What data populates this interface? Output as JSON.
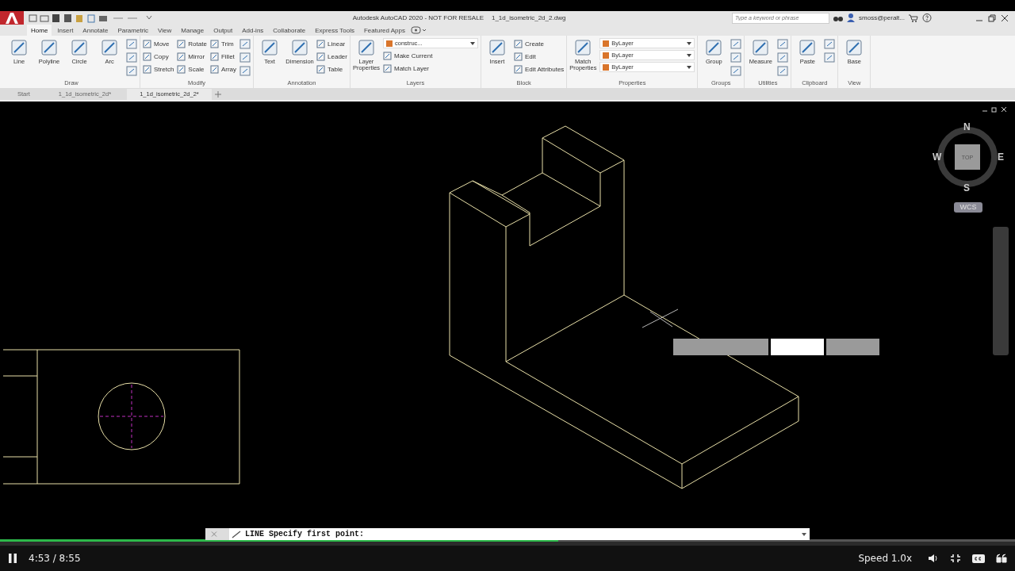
{
  "app": {
    "title": "Autodesk AutoCAD 2020 - NOT FOR RESALE",
    "file": "1_1d_isometric_2d_2.dwg",
    "search_placeholder": "Type a keyword or phrase",
    "user": "smoss@peralt..."
  },
  "ribbon_tabs": [
    {
      "label": "Home",
      "selected": true
    },
    {
      "label": "Insert",
      "selected": false
    },
    {
      "label": "Annotate",
      "selected": false
    },
    {
      "label": "Parametric",
      "selected": false
    },
    {
      "label": "View",
      "selected": false
    },
    {
      "label": "Manage",
      "selected": false
    },
    {
      "label": "Output",
      "selected": false
    },
    {
      "label": "Add-ins",
      "selected": false
    },
    {
      "label": "Collaborate",
      "selected": false
    },
    {
      "label": "Express Tools",
      "selected": false
    },
    {
      "label": "Featured Apps",
      "selected": false
    }
  ],
  "panels": [
    {
      "title": "Draw",
      "columns": [
        [
          {
            "kind": "large",
            "label": "Line"
          }
        ],
        [
          {
            "kind": "large",
            "label": "Polyline"
          }
        ],
        [
          {
            "kind": "large",
            "label": "Circle"
          }
        ],
        [
          {
            "kind": "large",
            "label": "Arc"
          }
        ],
        [
          {
            "kind": "icon"
          },
          {
            "kind": "icon"
          },
          {
            "kind": "icon"
          }
        ]
      ]
    },
    {
      "title": "Modify",
      "columns": [
        [
          {
            "kind": "small",
            "label": "Move"
          },
          {
            "kind": "small",
            "label": "Copy"
          },
          {
            "kind": "small",
            "label": "Stretch"
          }
        ],
        [
          {
            "kind": "small",
            "label": "Rotate"
          },
          {
            "kind": "small",
            "label": "Mirror"
          },
          {
            "kind": "small",
            "label": "Scale"
          }
        ],
        [
          {
            "kind": "small",
            "label": "Trim"
          },
          {
            "kind": "small",
            "label": "Fillet"
          },
          {
            "kind": "small",
            "label": "Array"
          }
        ],
        [
          {
            "kind": "icon"
          },
          {
            "kind": "icon"
          },
          {
            "kind": "icon"
          }
        ]
      ]
    },
    {
      "title": "Annotation",
      "columns": [
        [
          {
            "kind": "large",
            "label": "Text"
          }
        ],
        [
          {
            "kind": "large",
            "label": "Dimension"
          }
        ],
        [
          {
            "kind": "small",
            "label": "Linear"
          },
          {
            "kind": "small",
            "label": "Leader"
          },
          {
            "kind": "small",
            "label": "Table"
          }
        ]
      ]
    },
    {
      "title": "Layers",
      "columns": [
        [
          {
            "kind": "large",
            "label": "Layer Properties"
          }
        ],
        [
          {
            "kind": "dropdown",
            "label": "construc..."
          },
          {
            "kind": "small",
            "label": "Make Current"
          },
          {
            "kind": "small",
            "label": "Match Layer"
          }
        ]
      ]
    },
    {
      "title": "Block",
      "columns": [
        [
          {
            "kind": "large",
            "label": "Insert"
          }
        ],
        [
          {
            "kind": "small",
            "label": "Create"
          },
          {
            "kind": "small",
            "label": "Edit"
          },
          {
            "kind": "small",
            "label": "Edit Attributes"
          }
        ]
      ]
    },
    {
      "title": "Properties",
      "columns": [
        [
          {
            "kind": "large",
            "label": "Match Properties"
          }
        ],
        [
          {
            "kind": "dropdown",
            "label": "ByLayer"
          },
          {
            "kind": "dropdown",
            "label": "ByLayer"
          },
          {
            "kind": "dropdown",
            "label": "ByLayer"
          }
        ]
      ]
    },
    {
      "title": "Groups",
      "columns": [
        [
          {
            "kind": "large",
            "label": "Group"
          }
        ],
        [
          {
            "kind": "icon"
          },
          {
            "kind": "icon"
          },
          {
            "kind": "icon"
          }
        ]
      ]
    },
    {
      "title": "Utilities",
      "columns": [
        [
          {
            "kind": "large",
            "label": "Measure"
          }
        ],
        [
          {
            "kind": "icon"
          },
          {
            "kind": "icon"
          },
          {
            "kind": "icon"
          }
        ]
      ]
    },
    {
      "title": "Clipboard",
      "columns": [
        [
          {
            "kind": "large",
            "label": "Paste"
          }
        ],
        [
          {
            "kind": "icon"
          },
          {
            "kind": "icon"
          }
        ]
      ]
    },
    {
      "title": "View",
      "columns": [
        [
          {
            "kind": "large",
            "label": "Base"
          }
        ]
      ]
    }
  ],
  "file_tabs": [
    {
      "label": "Start",
      "selected": false
    },
    {
      "label": "1_1d_isometric_2d*",
      "selected": false
    },
    {
      "label": "1_1d_isometric_2d_2*",
      "selected": true
    }
  ],
  "viewcube": {
    "face": "TOP",
    "north": "N",
    "south": "S",
    "east": "E",
    "west": "W",
    "ucs": "WCS"
  },
  "dynamic_input": [
    {
      "selected": false
    },
    {
      "selected": true
    },
    {
      "selected": false
    }
  ],
  "command_line": {
    "prompt": "LINE Specify first point:"
  },
  "video": {
    "time": "4:53 / 8:55",
    "speed": "Speed 1.0x",
    "level": 0.55,
    "playing": true
  }
}
